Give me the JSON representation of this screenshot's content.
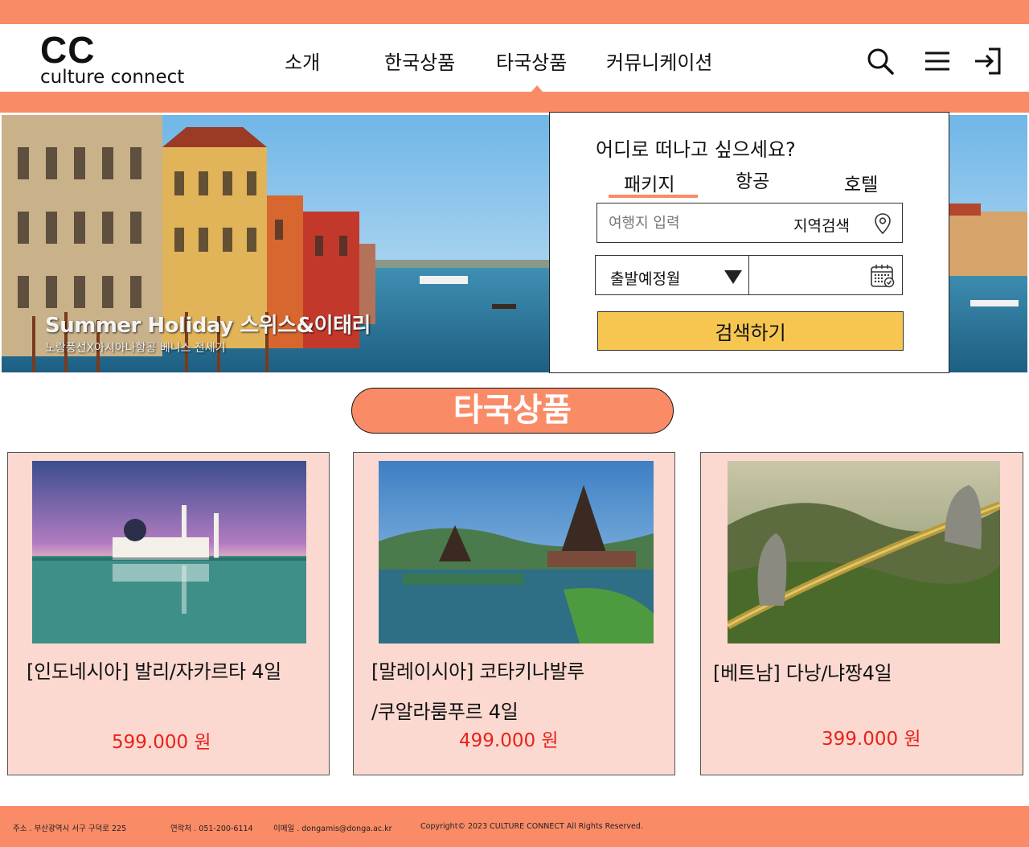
{
  "brand": {
    "logo_mark": "CC",
    "logo_text": "culture connect",
    "accent_color": "#fa8b67",
    "button_color": "#f6c651",
    "card_bg": "#fbd9d0",
    "price_color": "#e8221b"
  },
  "nav": {
    "items": [
      {
        "label": "소개"
      },
      {
        "label": "한국상품"
      },
      {
        "label": "타국상품",
        "active": true
      },
      {
        "label": "커뮤니케이션"
      }
    ],
    "icons": [
      "search-icon",
      "menu-icon",
      "login-icon"
    ]
  },
  "hero": {
    "title": "Summer Holiday 스위스&이태리",
    "subtitle": "노랑풍선X아시아나항공 베니스 전세기"
  },
  "search": {
    "question": "어디로 떠나고 싶으세요?",
    "tabs": [
      {
        "label": "패키지",
        "active": true
      },
      {
        "label": "항공"
      },
      {
        "label": "호텔"
      }
    ],
    "destination_placeholder": "여행지 입력",
    "destination_value": "",
    "region_search_label": "지역검색",
    "month_label": "출발예정월",
    "submit_label": "검색하기"
  },
  "section": {
    "title": "타국상품"
  },
  "products": [
    {
      "title_line1": "[인도네시아] 발리/자카르타 4일",
      "title_line2": "",
      "price": "599.000 원",
      "image": "mosque-lake"
    },
    {
      "title_line1": "[말레이시아] 코타키나발루",
      "title_line2": "/쿠알라룸푸르 4일",
      "price": "499.000 원",
      "image": "temple-lake"
    },
    {
      "title_line1": "[베트남] 다낭/냐짱4일",
      "title_line2": "",
      "price": "399.000 원",
      "image": "golden-bridge"
    }
  ],
  "footer": {
    "address": "주소 . 부산광역시 서구 구덕로 225",
    "phone": "연락처 . 051-200-6114",
    "email": "이메일 . dongamis@donga.ac.kr",
    "copyright": "Copyright© 2023 CULTURE CONNECT All Rights Reserved."
  }
}
